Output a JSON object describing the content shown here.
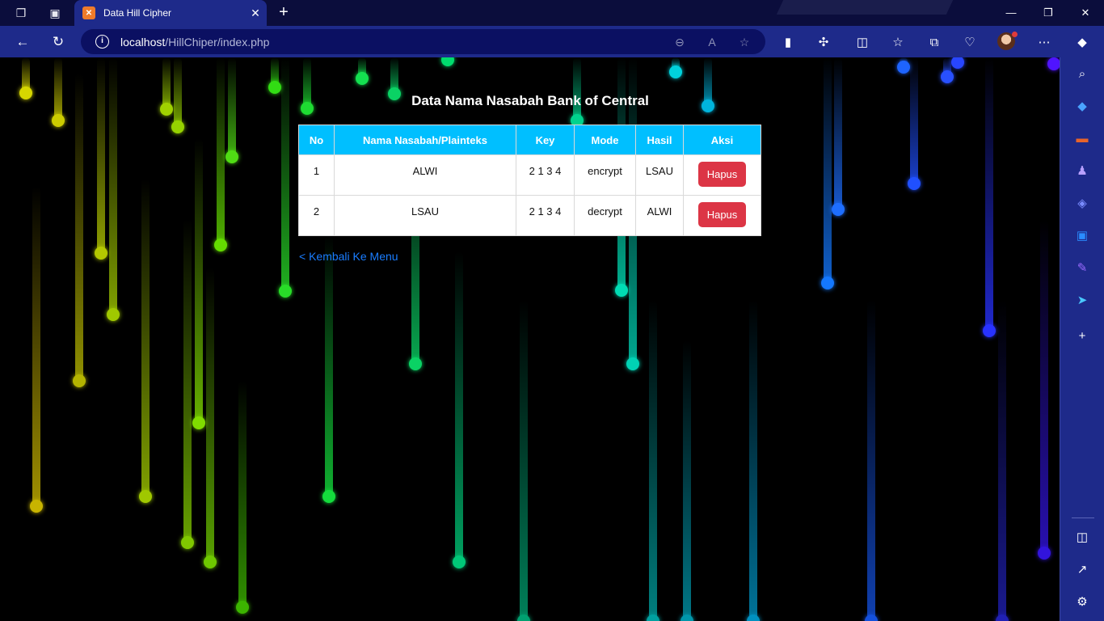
{
  "browser": {
    "tab_title": "Data Hill Cipher",
    "tab_favicon": "xampp-favicon-icon",
    "url_host": "localhost",
    "url_path": "/HillChiper/index.php",
    "accent": "#1e2a8a"
  },
  "page": {
    "title": "Data Nama Nasabah Bank of Central",
    "back_link": "< Kembali Ke Menu",
    "table": {
      "headers": [
        "No",
        "Nama Nasabah/Plainteks",
        "Key",
        "Mode",
        "Hasil",
        "Aksi"
      ],
      "rows": [
        {
          "no": "1",
          "nama": "ALWI",
          "key": "2 1 3 4",
          "mode": "encrypt",
          "hasil": "LSAU",
          "aksi": "Hapus"
        },
        {
          "no": "2",
          "nama": "LSAU",
          "key": "2 1 3 4",
          "mode": "decrypt",
          "hasil": "ALWI",
          "aksi": "Hapus"
        }
      ]
    },
    "colors": {
      "header_bg": "#00bfff",
      "delete_button": "#dc3545",
      "link": "#1a7dff"
    }
  }
}
